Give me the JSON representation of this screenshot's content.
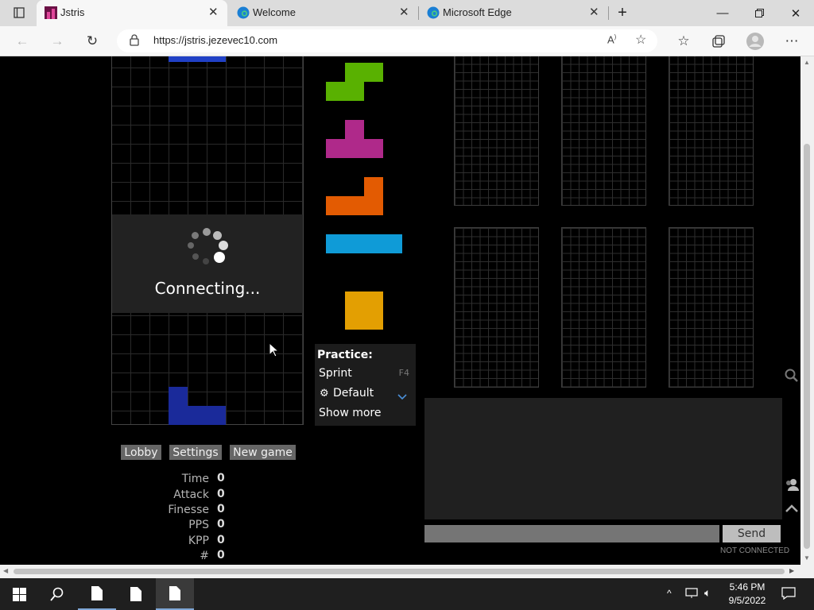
{
  "browser": {
    "tabs": [
      {
        "title": "Jstris",
        "active": true
      },
      {
        "title": "Welcome",
        "active": false
      },
      {
        "title": "Microsoft Edge",
        "active": false
      }
    ],
    "url": "https://jstris.jezevec10.com"
  },
  "game": {
    "status_text": "Connecting...",
    "practice": {
      "title": "Practice:",
      "items": [
        {
          "label": "Sprint",
          "shortcut": "F4"
        },
        {
          "label": "Default"
        },
        {
          "label": "Show more"
        }
      ]
    },
    "buttons": {
      "lobby": "Lobby",
      "settings": "Settings",
      "new_game": "New game"
    },
    "stats": [
      {
        "label": "Time",
        "value": "0"
      },
      {
        "label": "Attack",
        "value": "0"
      },
      {
        "label": "Finesse",
        "value": "0"
      },
      {
        "label": "PPS",
        "value": "0"
      },
      {
        "label": "KPP",
        "value": "0"
      },
      {
        "label": "#",
        "value": "0"
      }
    ],
    "queue_pieces": [
      "S",
      "T",
      "L",
      "I",
      "O"
    ],
    "piece_colors": {
      "S": "#59b101",
      "T": "#af298a",
      "L": "#e35b02",
      "I": "#0f9bd7",
      "O": "#e39f02",
      "J": "#2141c6"
    },
    "chat": {
      "send_label": "Send",
      "status": "NOT CONNECTED"
    }
  },
  "taskbar": {
    "time": "5:46 PM",
    "date": "9/5/2022"
  }
}
